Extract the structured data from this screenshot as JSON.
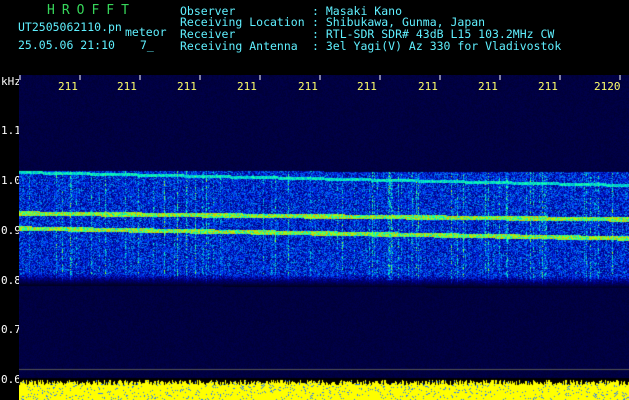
{
  "header": {
    "brand": "HROFFT",
    "filename": "UT2505062110.pn",
    "mode": "meteor",
    "datetime": "25.05.06 21:10",
    "count": "7_",
    "fields": [
      {
        "label": "Observer",
        "value": ": Masaki Kano"
      },
      {
        "label": "Receiving Location",
        "value": ": Shibukawa, Gunma, Japan"
      },
      {
        "label": "Receiver",
        "value": ": RTL-SDR SDR# 43dB L15 103.2MHz CW"
      },
      {
        "label": "Receiving Antenna",
        "value": ": 3el Yagi(V) Az 330 for Vladivostok"
      }
    ]
  },
  "plot": {
    "yaxis_unit": "kHz",
    "ylabels": [
      "1.1",
      "1.0",
      "0.9",
      "0.8",
      "0.7",
      "0.6"
    ],
    "time_labels": [
      "211",
      "211",
      "211",
      "211",
      "211",
      "211",
      "211",
      "211",
      "211",
      "2120"
    ],
    "colors": {
      "background": "#00003a",
      "trace": "#00ff70",
      "baseline": "#ffff00"
    }
  }
}
